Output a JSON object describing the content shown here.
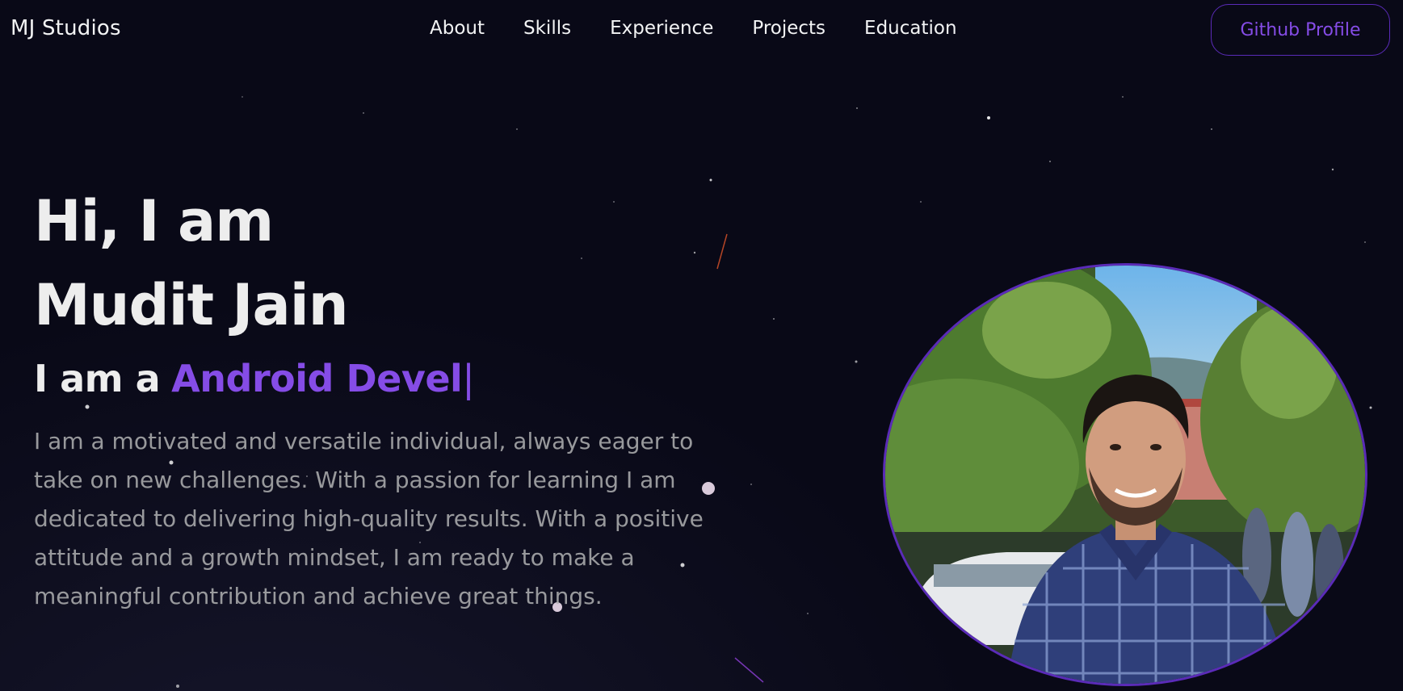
{
  "navbar": {
    "brand": "MJ Studios",
    "links": [
      "About",
      "Skills",
      "Experience",
      "Projects",
      "Education"
    ],
    "github_button": "Github Profile"
  },
  "hero": {
    "title_line1": "Hi, I am",
    "title_line2": "Mudit Jain",
    "role_prefix": "I am a",
    "role_typed": "Android Devel",
    "cursor": "|",
    "bio": "I am a motivated and versatile individual, always eager to take on new challenges. With a passion for learning I am dedicated to delivering high-quality results. With a positive attitude and a growth mindset, I am ready to make a meaningful contribution and achieve great things."
  },
  "colors": {
    "background": "#090917",
    "accent": "#854ce6",
    "border_accent": "#5a2bb8",
    "text_primary": "#f2f3f4",
    "text_secondary": "#b1b2b3"
  },
  "profile": {
    "image_semantic": "profile-photo"
  }
}
